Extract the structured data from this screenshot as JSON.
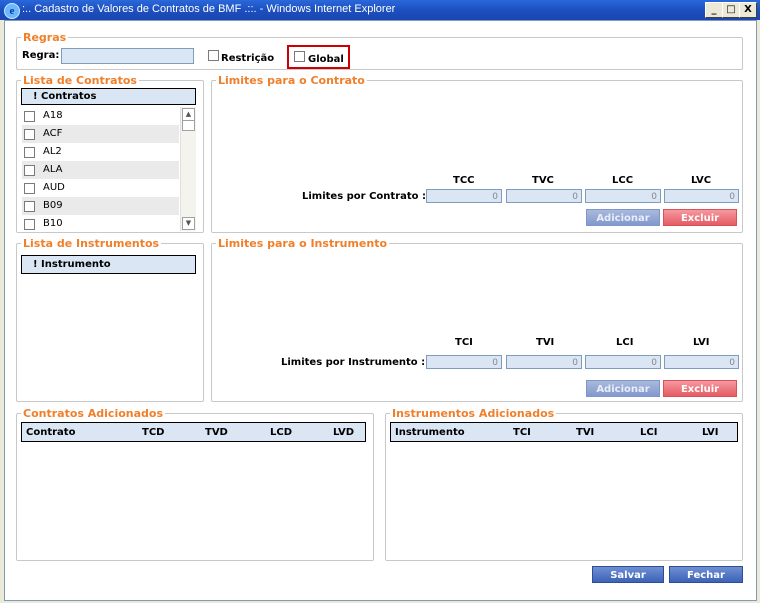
{
  "window": {
    "title": ":.. Cadastro de Valores de Contratos de BMF .::. - Windows Internet Explorer",
    "icon": "ie-icon",
    "controls": [
      "_",
      "□",
      "X"
    ]
  },
  "regras": {
    "legend": "Regras",
    "regra_label": "Regra:",
    "regra_value": "",
    "restricao_label": "Restrição",
    "restricao_checked": false,
    "global_label": "Global",
    "global_checked": false
  },
  "lista_contratos": {
    "legend": "Lista de Contratos",
    "header": "! Contratos",
    "items": [
      {
        "label": "A18",
        "checked": false
      },
      {
        "label": "ACF",
        "checked": false
      },
      {
        "label": "AL2",
        "checked": false
      },
      {
        "label": "ALA",
        "checked": false
      },
      {
        "label": "AUD",
        "checked": false
      },
      {
        "label": "B09",
        "checked": false
      },
      {
        "label": "B10",
        "checked": false
      }
    ]
  },
  "limites_contrato": {
    "legend": "Limites para o Contrato",
    "columns": [
      "TCC",
      "TVC",
      "LCC",
      "LVC"
    ],
    "row_label": "Limites por Contrato :",
    "values": [
      "0",
      "0",
      "0",
      "0"
    ],
    "add_label": "Adicionar",
    "delete_label": "Excluir"
  },
  "lista_instrumentos": {
    "legend": "Lista de Instrumentos",
    "header": "! Instrumento"
  },
  "limites_instrumento": {
    "legend": "Limites para o Instrumento",
    "columns": [
      "TCI",
      "TVI",
      "LCI",
      "LVI"
    ],
    "row_label": "Limites por Instrumento :",
    "values": [
      "0",
      "0",
      "0",
      "0"
    ],
    "add_label": "Adicionar",
    "delete_label": "Excluir"
  },
  "contratos_adicionados": {
    "legend": "Contratos Adicionados",
    "columns": [
      "Contrato",
      "TCD",
      "TVD",
      "LCD",
      "LVD"
    ]
  },
  "instrumentos_adicionados": {
    "legend": "Instrumentos Adicionados",
    "columns": [
      "Instrumento",
      "TCI",
      "TVI",
      "LCI",
      "LVI"
    ]
  },
  "footer": {
    "save_label": "Salvar",
    "close_label": "Fechar"
  },
  "colors": {
    "legend": "#f07f2a",
    "title_bar": "#1c4fc0",
    "input_bg": "#dbe6f5",
    "delete_button": "#e55b63",
    "highlight": "#cc0000"
  }
}
